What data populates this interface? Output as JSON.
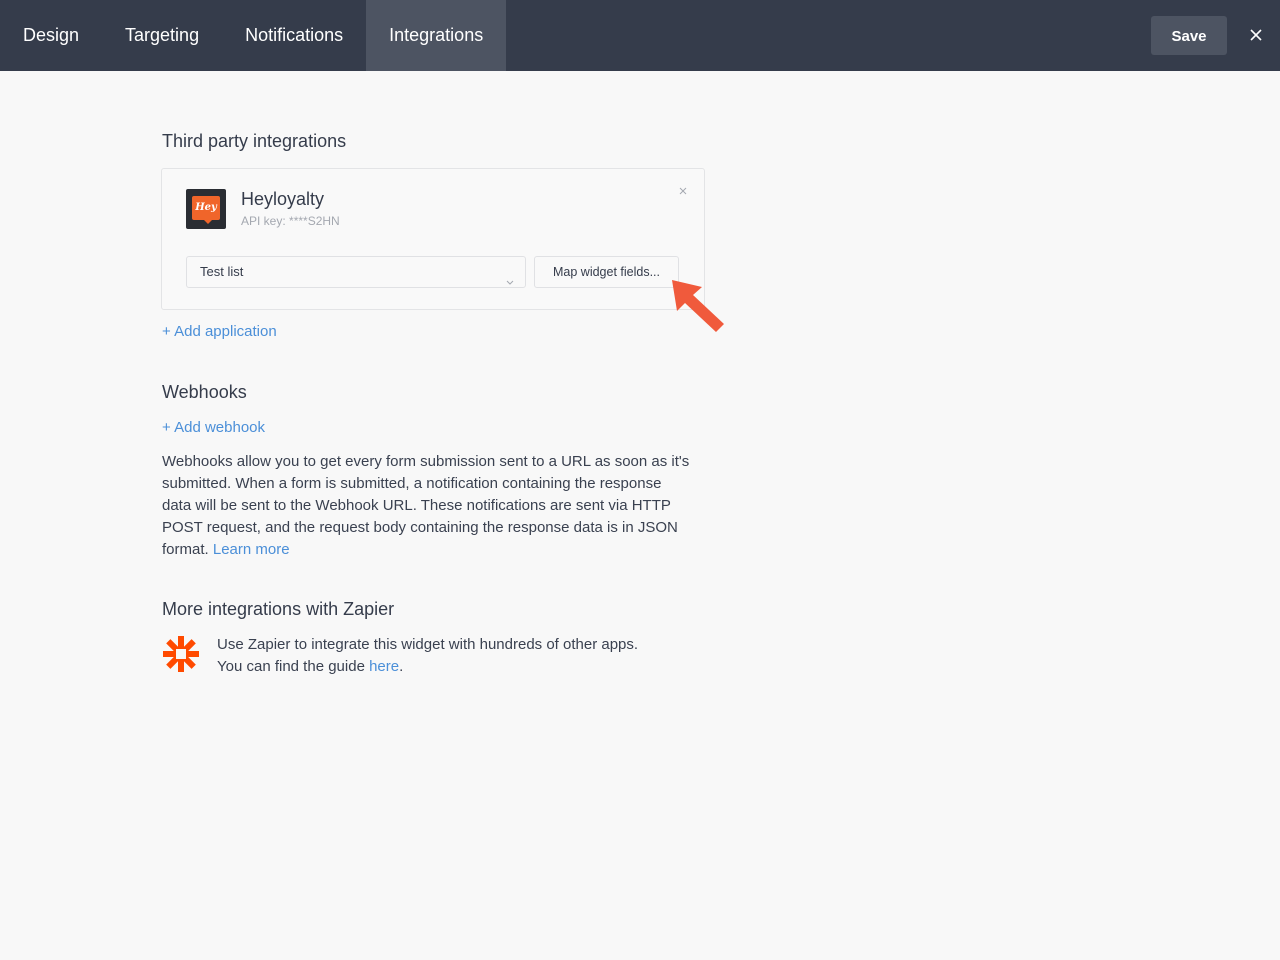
{
  "header": {
    "tabs": [
      {
        "label": "Design",
        "active": false
      },
      {
        "label": "Targeting",
        "active": false
      },
      {
        "label": "Notifications",
        "active": false
      },
      {
        "label": "Integrations",
        "active": true
      }
    ],
    "save_label": "Save",
    "close_icon": "close-icon"
  },
  "third_party": {
    "title": "Third party integrations",
    "integration": {
      "name": "Heyloyalty",
      "logo_text": "Hey",
      "api_key": "API key: ****S2HN",
      "list_value": "Test list",
      "map_button": "Map widget fields..."
    },
    "add_application": "+ Add application"
  },
  "webhooks": {
    "title": "Webhooks",
    "add_webhook": "+ Add webhook",
    "description": "Webhooks allow you to get every form submission sent to a URL as soon as it's submitted. When a form is submitted, a notification containing the response data will be sent to the Webhook URL. These notifications are sent via HTTP POST request, and the request body containing the response data is in JSON format. ",
    "learn_more": "Learn more"
  },
  "zapier": {
    "title": "More integrations with Zapier",
    "line1": "Use Zapier to integrate this widget with hundreds of other apps.",
    "line2_prefix": "You can find the guide ",
    "here_link": "here",
    "line2_suffix": "."
  },
  "colors": {
    "topbar": "#353c4b",
    "active_tab": "#4d5462",
    "link": "#4b8fd8",
    "accent_arrow": "#f05a3c",
    "zapier_orange": "#ff4a00"
  }
}
